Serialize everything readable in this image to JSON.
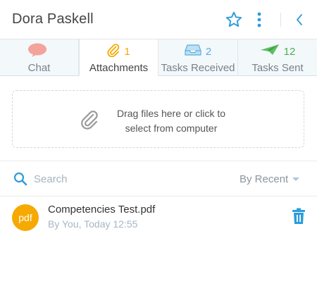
{
  "header": {
    "title": "Dora Paskell",
    "star_icon": "star-outline-icon",
    "menu_icon": "kebab-menu-icon",
    "back_icon": "chevron-left-icon",
    "accent": "#2d9cdb"
  },
  "tabs": [
    {
      "label": "Chat",
      "count": "",
      "icon": "speech-bubble-icon",
      "color": "#f2a39b",
      "active": false
    },
    {
      "label": "Attachments",
      "count": "1",
      "icon": "paperclip-icon",
      "color": "#f6a900",
      "active": true
    },
    {
      "label": "Tasks Received",
      "count": "2",
      "icon": "inbox-tray-icon",
      "color": "#5aaee0",
      "active": false
    },
    {
      "label": "Tasks Sent",
      "count": "12",
      "icon": "paper-plane-icon",
      "color": "#4caf50",
      "active": false
    }
  ],
  "dropzone": {
    "line1": "Drag files here or click to",
    "line2": "select from computer",
    "icon": "paperclip-icon"
  },
  "search": {
    "placeholder": "Search",
    "value": ""
  },
  "sort": {
    "label": "By Recent"
  },
  "files": [
    {
      "type_badge": "pdf",
      "name": "Competencies Test.pdf",
      "meta": "By You, Today 12:55",
      "badge_color": "#f6a900"
    }
  ]
}
